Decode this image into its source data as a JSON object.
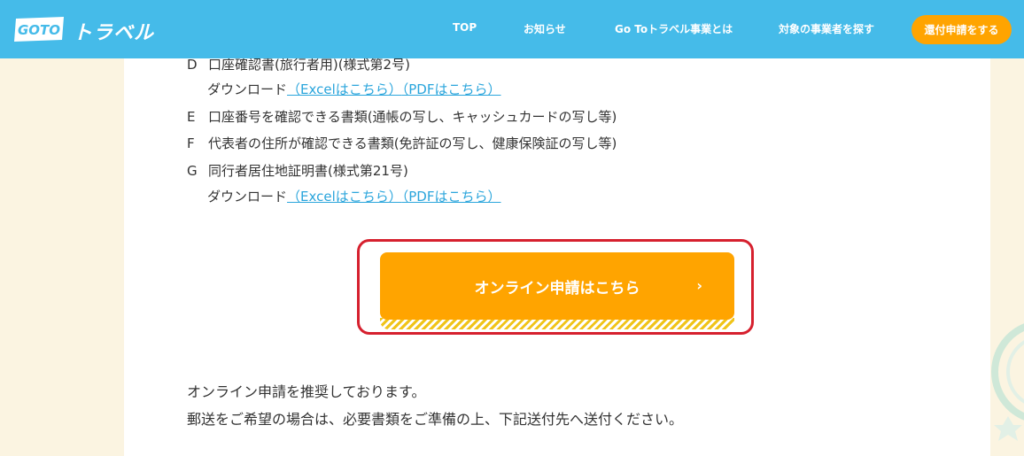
{
  "header": {
    "logo_badge": "GOTO",
    "logo_text": "トラベル",
    "nav": [
      "TOP",
      "お知らせ",
      "Go Toトラベル事業とは",
      "対象の事業者を探す"
    ],
    "cta": "還付申請をする"
  },
  "documents": [
    {
      "letter": "D",
      "text": "口座確認書(旅行者用)(様式第2号)"
    },
    {
      "letter": "E",
      "text": "口座番号を確認できる書類(通帳の写し、キャッシュカードの写し等)"
    },
    {
      "letter": "F",
      "text": "代表者の住所が確認できる書類(免許証の写し、健康保険証の写し等)"
    },
    {
      "letter": "G",
      "text": "同行者居住地証明書(様式第21号)"
    }
  ],
  "download": {
    "label": "ダウンロード",
    "excel": "（Excelはこちら）",
    "pdf": "（PDFはこちら）"
  },
  "apply_button": {
    "label": "オンライン申請はこちら",
    "chevron": "›"
  },
  "paragraphs": [
    "オンライン申請を推奨しております。",
    "郵送をご希望の場合は、必要書類をご準備の上、下記送付先へ送付ください。"
  ],
  "colors": {
    "header": "#45bbe9",
    "accent": "#ffa400",
    "link": "#2aa5dc",
    "highlight": "#d6202e"
  }
}
